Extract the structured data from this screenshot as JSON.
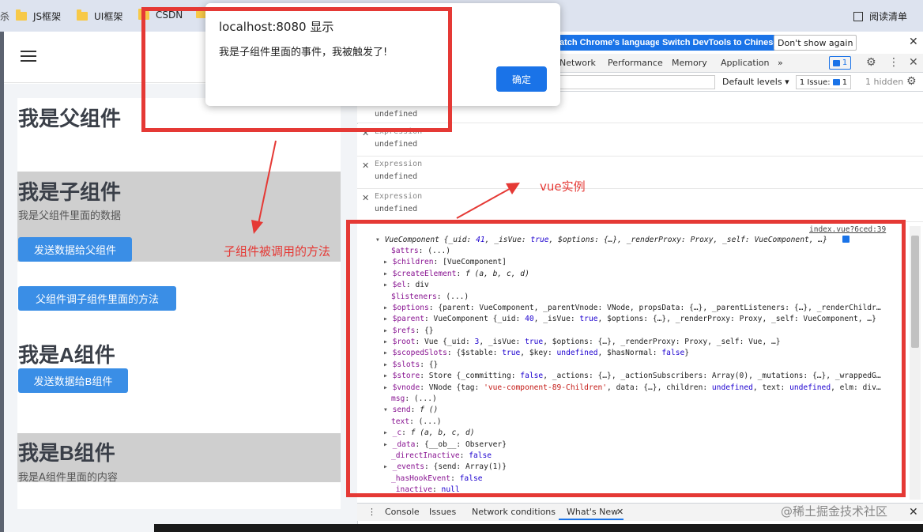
{
  "bookmarks": {
    "partial": "杀",
    "items": [
      "JS框架",
      "UI框架",
      "CSDN",
      ""
    ],
    "reading_list": "阅读清单"
  },
  "app": {
    "parent_title": "我是父组件",
    "child_title": "我是子组件",
    "child_data_text": "我是父组件里面的数据",
    "send_to_parent_btn": "发送数据给父组件",
    "parent_call_child_btn": "父组件调子组件里面的方法",
    "a_title": "我是A组件",
    "send_to_b_btn": "发送数据给B组件",
    "b_title": "我是B组件",
    "b_content_text": "我是A组件里面的内容"
  },
  "annotations": {
    "child_method_called": "子组件被调用的方法",
    "vue_instance": "vue实例"
  },
  "alert": {
    "title": "localhost:8080 显示",
    "message": "我是子组件里面的事件，我被触发了!",
    "ok": "确定"
  },
  "devtools": {
    "lang_switch_partial": "atch Chrome's language",
    "lang_switch_zh": "Switch DevTools to Chinese",
    "dont_show": "Don't show again",
    "tabs": [
      "Network",
      "Performance",
      "Memory",
      "Application",
      "»"
    ],
    "issues_count": "1",
    "levels": "Default levels ▾",
    "issue_btn": "1 Issue:",
    "issue_btn_count": "1",
    "hidden": "1 hidden",
    "expressions": [
      {
        "label": "",
        "value": "undefined"
      },
      {
        "label": "Expression",
        "value": "undefined"
      },
      {
        "label": "Expression",
        "value": "undefined"
      },
      {
        "label": "Expression",
        "value": "undefined"
      }
    ],
    "source_link": "index.vue?6ced:39",
    "drawer_tabs": [
      "Console",
      "Issues",
      "Network conditions",
      "What's New"
    ]
  },
  "watermark": "@稀土掘金技术社区"
}
